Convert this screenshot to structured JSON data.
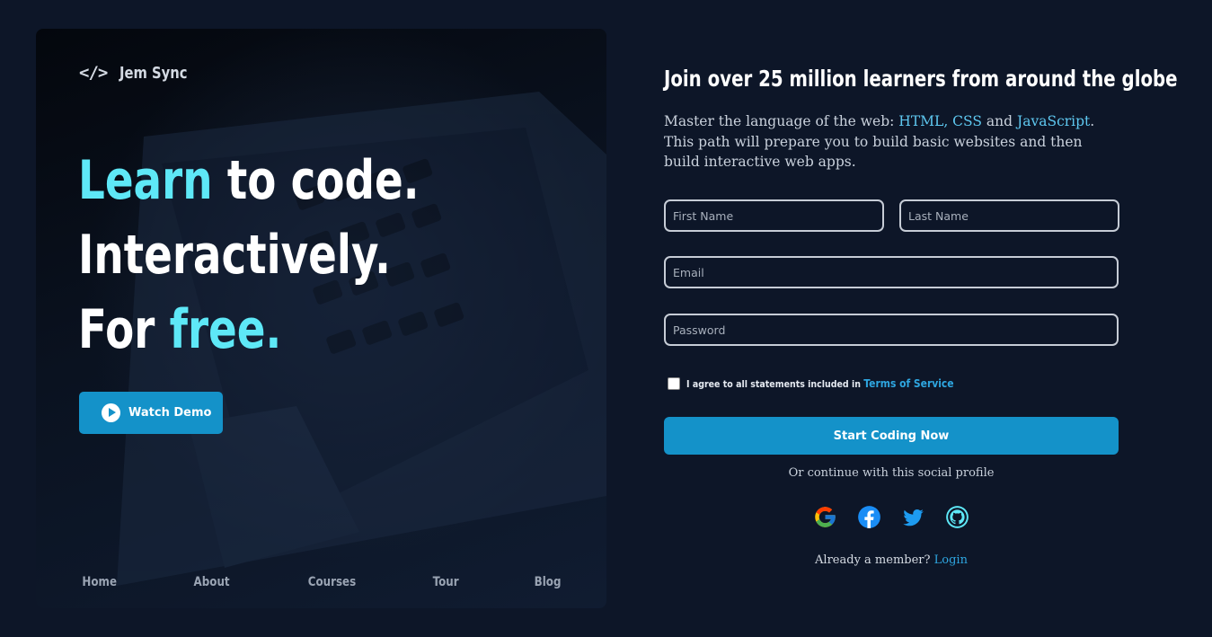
{
  "brand": {
    "icon": "code-brackets-icon",
    "glyph": "</>",
    "name": "Jem Sync"
  },
  "hero": {
    "line1_a": "Learn",
    "line1_b": " to code.",
    "line2": "Interactively.",
    "line3_a": "For ",
    "line3_b": "free.",
    "demo_button": "Watch Demo"
  },
  "nav": [
    "Home",
    "About",
    "Courses",
    "Tour",
    "Blog"
  ],
  "form": {
    "title": "Join over 25 million learners from around the globe",
    "desc_pre": "Master the language of the web: ",
    "desc_link1": "HTML, CSS",
    "desc_mid": " and ",
    "desc_link2": "JavaScript",
    "desc_post": ". This path will prepare you to build basic websites and then build interactive web apps.",
    "first_name_placeholder": "First Name",
    "last_name_placeholder": "Last Name",
    "email_placeholder": "Email",
    "password_placeholder": "Password",
    "agree_text": "I agree to all statements included in ",
    "terms_link": "Terms of Service",
    "submit_label": "Start Coding Now",
    "social_text": "Or continue with this social profile",
    "member_text": "Already a member? ",
    "login_link": "Login"
  },
  "social_icons": [
    "google-icon",
    "facebook-icon",
    "twitter-icon",
    "github-icon"
  ],
  "colors": {
    "background": "#0d1628",
    "accent": "#5ee8f7",
    "button": "#1492c9",
    "link": "#2ea6e0"
  }
}
